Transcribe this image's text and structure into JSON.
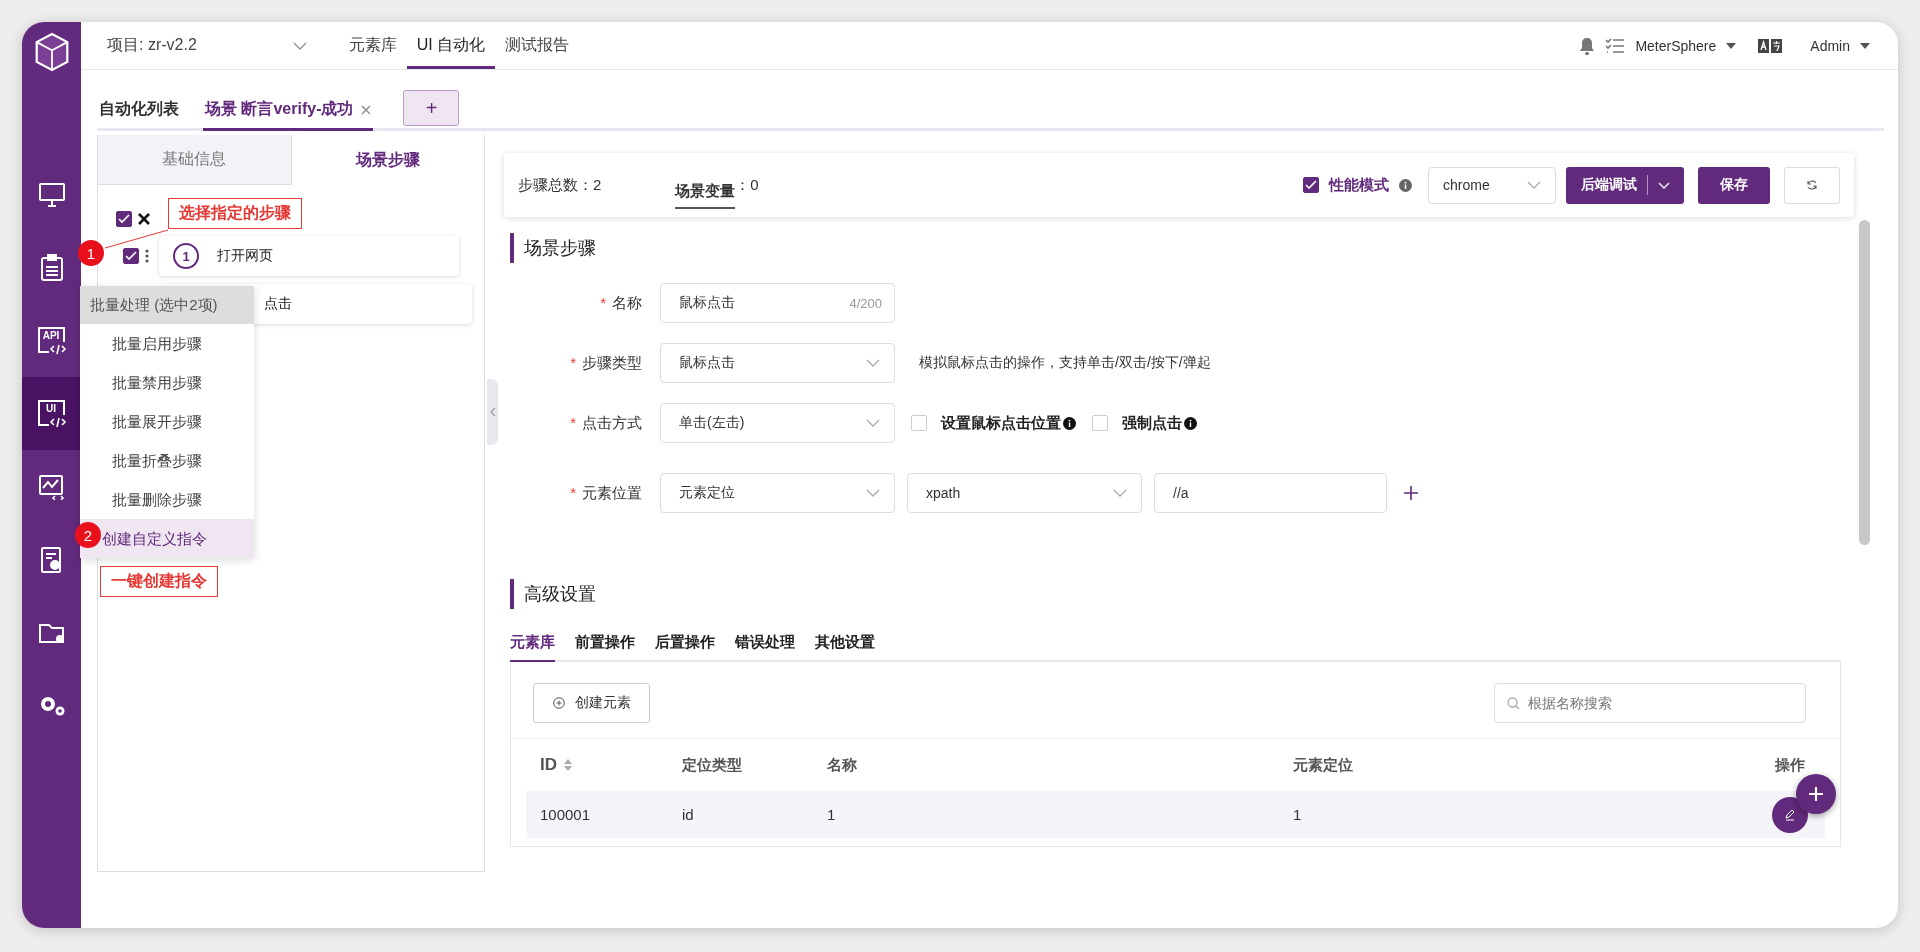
{
  "sidebar": {
    "items": [
      {
        "kind": "monitor",
        "selected": false
      },
      {
        "kind": "clipboard",
        "selected": false
      },
      {
        "kind": "api",
        "label": "API",
        "selected": false
      },
      {
        "kind": "ui",
        "label": "UI",
        "selected": true
      },
      {
        "kind": "chart",
        "selected": false
      },
      {
        "kind": "report",
        "selected": false
      },
      {
        "kind": "folder",
        "selected": false
      },
      {
        "kind": "gears",
        "selected": false
      }
    ]
  },
  "header": {
    "project": "项目: zr-v2.2",
    "nav": [
      {
        "label": "元素库",
        "selected": false
      },
      {
        "label": "UI 自动化",
        "selected": true
      },
      {
        "label": "测试报告",
        "selected": false
      }
    ],
    "workspace": "MeterSphere",
    "user": "Admin"
  },
  "tabs": [
    {
      "label": "自动化列表",
      "selected": false,
      "closable": false
    },
    {
      "label": "场景 断言verify-成功",
      "selected": true,
      "closable": true
    }
  ],
  "add_tab": "+",
  "left_panel": {
    "tabs": [
      {
        "label": "基础信息",
        "selected": false
      },
      {
        "label": "场景步骤",
        "selected": true
      }
    ],
    "select_all": {
      "checked": true
    },
    "steps": [
      {
        "number": "1",
        "name": "打开网页",
        "checked": true
      },
      {
        "name": "点击"
      }
    ]
  },
  "context_menu": {
    "title": "批量处理 (选中2项)",
    "items": [
      {
        "label": "批量启用步骤",
        "selected": false
      },
      {
        "label": "批量禁用步骤",
        "selected": false
      },
      {
        "label": "批量展开步骤",
        "selected": false
      },
      {
        "label": "批量折叠步骤",
        "selected": false
      },
      {
        "label": "批量删除步骤",
        "selected": false
      },
      {
        "label": "创建自定义指令",
        "selected": true
      }
    ]
  },
  "annotations": [
    {
      "number": "1",
      "text": "选择指定的步骤"
    },
    {
      "number": "2",
      "text": "一键创建指令"
    }
  ],
  "toolbar": {
    "step_total_label": "步骤总数：",
    "step_total": "2",
    "variables_label": "场景变量",
    "variables": "：0",
    "performance_mode": {
      "label": "性能模式",
      "checked": true
    },
    "browser": "chrome",
    "debug_button": "后端调试",
    "save_button": "保存"
  },
  "scene_steps": {
    "title": "场景步骤",
    "fields": [
      {
        "kind": "input",
        "required_mark": "*",
        "label": "名称",
        "value": "鼠标点击",
        "counter": "4/200"
      },
      {
        "kind": "select",
        "required_mark": "*",
        "label": "步骤类型",
        "value": "鼠标点击",
        "hint": "模拟鼠标点击的操作，支持单击/双击/按下/弹起"
      },
      {
        "kind": "select",
        "required_mark": "*",
        "label": "点击方式",
        "value": "单击(左击)",
        "checkboxes": [
          {
            "label": "设置鼠标点击位置",
            "checked": false
          },
          {
            "label": "强制点击",
            "checked": false
          }
        ]
      },
      {
        "kind": "locator",
        "required_mark": "*",
        "label": "元素位置",
        "value": "元素定位",
        "locator_type": "xpath",
        "expression": "//a"
      }
    ]
  },
  "advanced": {
    "title": "高级设置",
    "tabs": [
      {
        "label": "元素库",
        "selected": true
      },
      {
        "label": "前置操作",
        "selected": false
      },
      {
        "label": "后置操作",
        "selected": false
      },
      {
        "label": "错误处理",
        "selected": false
      },
      {
        "label": "其他设置",
        "selected": false
      }
    ],
    "create_button": "创建元素",
    "search": {
      "placeholder": "根据名称搜索"
    },
    "table": {
      "columns": [
        "ID",
        "定位类型",
        "名称",
        "元素定位",
        "操作"
      ],
      "rows": [
        [
          "100001",
          "id",
          "1",
          "1"
        ]
      ]
    }
  }
}
